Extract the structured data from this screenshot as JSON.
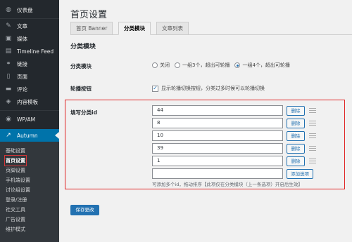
{
  "sidebar": {
    "items": [
      {
        "label": "仪表盘",
        "icon": "dashboard-icon",
        "glyph": "◍"
      },
      {
        "label": "文章",
        "icon": "pin-icon",
        "glyph": "✎"
      },
      {
        "label": "媒体",
        "icon": "media-icon",
        "glyph": "▣"
      },
      {
        "label": "Timeline Feed",
        "icon": "feed-icon",
        "glyph": "▤"
      },
      {
        "label": "链接",
        "icon": "link-icon",
        "glyph": "⚭"
      },
      {
        "label": "页面",
        "icon": "page-icon",
        "glyph": "▯"
      },
      {
        "label": "评论",
        "icon": "comment-icon",
        "glyph": "▬"
      },
      {
        "label": "内容模板",
        "icon": "template-icon",
        "glyph": "◈"
      },
      {
        "label": "WP/AM",
        "icon": "wpam-icon",
        "glyph": "◉"
      },
      {
        "label": "Autumn",
        "icon": "wrench-icon",
        "glyph": "↗"
      }
    ],
    "submenu": [
      "基础设置",
      "首页设置",
      "页脚设置",
      "手机端设置",
      "讨论组设置",
      "登录/注册",
      "社交工具",
      "广告设置",
      "维护模式"
    ]
  },
  "page": {
    "title": "首页设置",
    "tabs": [
      "首页 Banner",
      "分类模块",
      "文章列表"
    ],
    "section_title": "分类模块"
  },
  "category_module": {
    "label": "分类模块",
    "options": [
      "关闭",
      "一组3个，超出可轮播",
      "一组4个，超出可轮播"
    ],
    "selected": "一组4个，超出可轮播"
  },
  "carousel_buttons": {
    "label": "轮播按钮",
    "checkbox_text": "显示轮播切换按钮，分类过多时候可以轮播切换",
    "checked": true
  },
  "category_ids": {
    "label": "填写分类id",
    "values": [
      "44",
      "8",
      "10",
      "39",
      "1",
      ""
    ],
    "delete_label": "删除",
    "add_label": "添加选项",
    "hint": "可添加多个id，拖动排序【此项仅在分类模块（上一条选项）开启后生效】"
  },
  "save_button": "保存更改",
  "colors": {
    "sidebar_bg": "#23282d",
    "accent": "#2271b1",
    "highlight_border": "#e02424"
  }
}
